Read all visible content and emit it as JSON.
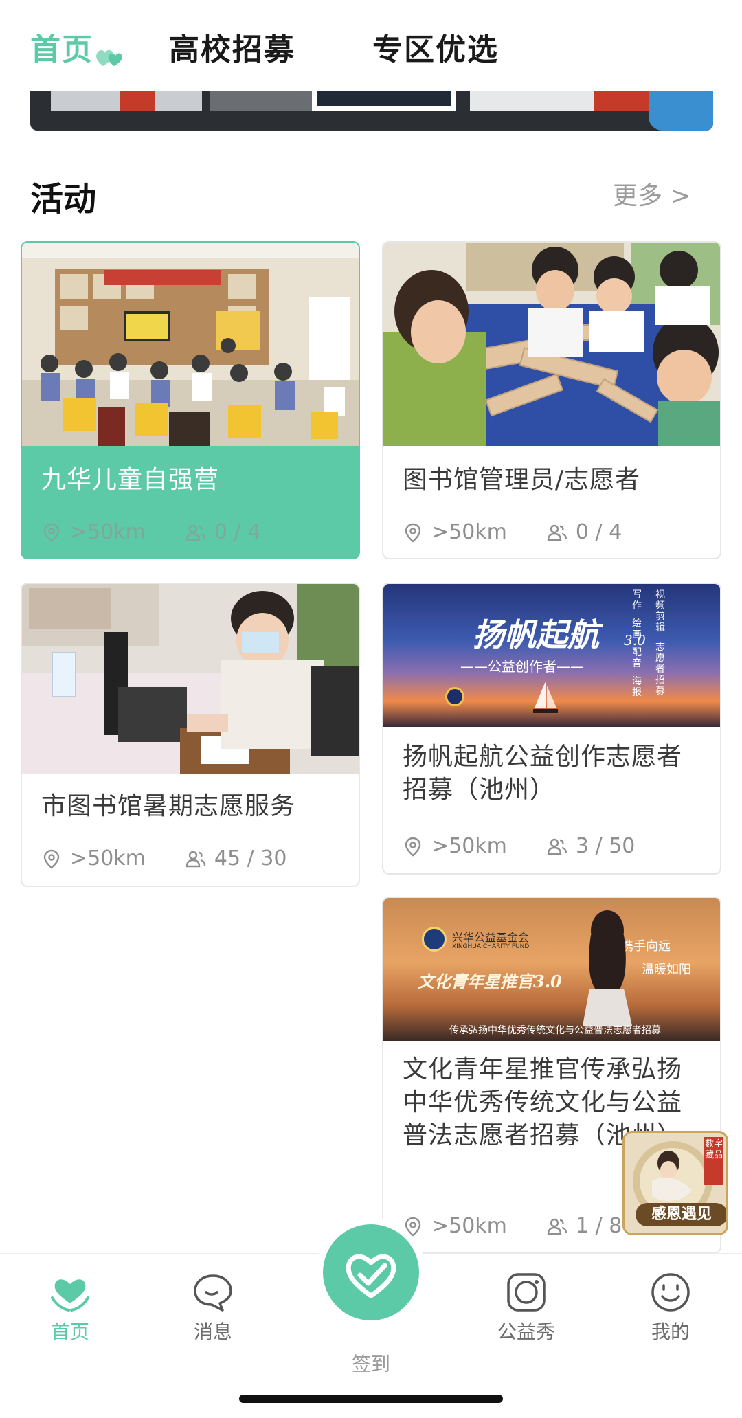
{
  "top_tabs": [
    {
      "label": "首页",
      "active": true
    },
    {
      "label": "高校招募",
      "active": false
    },
    {
      "label": "专区优选",
      "active": false
    }
  ],
  "section": {
    "title": "活动",
    "more": "更多 >"
  },
  "activities": [
    {
      "title": "九华儿童自强营",
      "distance": ">50km",
      "participants": "0 / 4"
    },
    {
      "title": "图书馆管理员/志愿者",
      "distance": ">50km",
      "participants": "0 / 4"
    },
    {
      "title": "市图书馆暑期志愿服务",
      "distance": ">50km",
      "participants": "45 / 30"
    },
    {
      "title": "扬帆起航公益创作志愿者招募（池州）",
      "distance": ">50km",
      "participants": "3 / 50",
      "image_text": {
        "headline": "扬帆起航",
        "version": "3.0",
        "subline": "——公益创作者——",
        "side_lines": [
          "写作",
          "绘画",
          "配音",
          "海报",
          "视频剪辑",
          "志愿者招募"
        ]
      }
    },
    {
      "title": "文化青年星推官传承弘扬中华优秀传统文化与公益普法志愿者招募（池州）",
      "distance": ">50km",
      "participants": "1 / 8",
      "image_text": {
        "org": "兴华公益基金会",
        "org_en": "XINGHUA CHARITY FUND",
        "headline": "文化青年星推官3.0",
        "slogan_1": "携手向远",
        "slogan_2": "温暖如阳",
        "bottom": "传承弘扬中华优秀传统文化与公益普法志愿者招募"
      }
    }
  ],
  "float_badge": {
    "label": "感恩遇见",
    "tag": "数字藏品"
  },
  "bottom_nav": [
    {
      "label": "首页",
      "icon": "heart-hands-icon",
      "active": true
    },
    {
      "label": "消息",
      "icon": "chat-bubble-icon",
      "active": false
    },
    {
      "label": "签到",
      "icon": "heart-hand-check-icon",
      "active": false
    },
    {
      "label": "公益秀",
      "icon": "camera-lens-icon",
      "active": false
    },
    {
      "label": "我的",
      "icon": "smiley-face-icon",
      "active": false
    }
  ],
  "colors": {
    "accent": "#5cc9a7",
    "text_dark": "#1a1a1a",
    "text_muted": "#8f8f8f"
  }
}
